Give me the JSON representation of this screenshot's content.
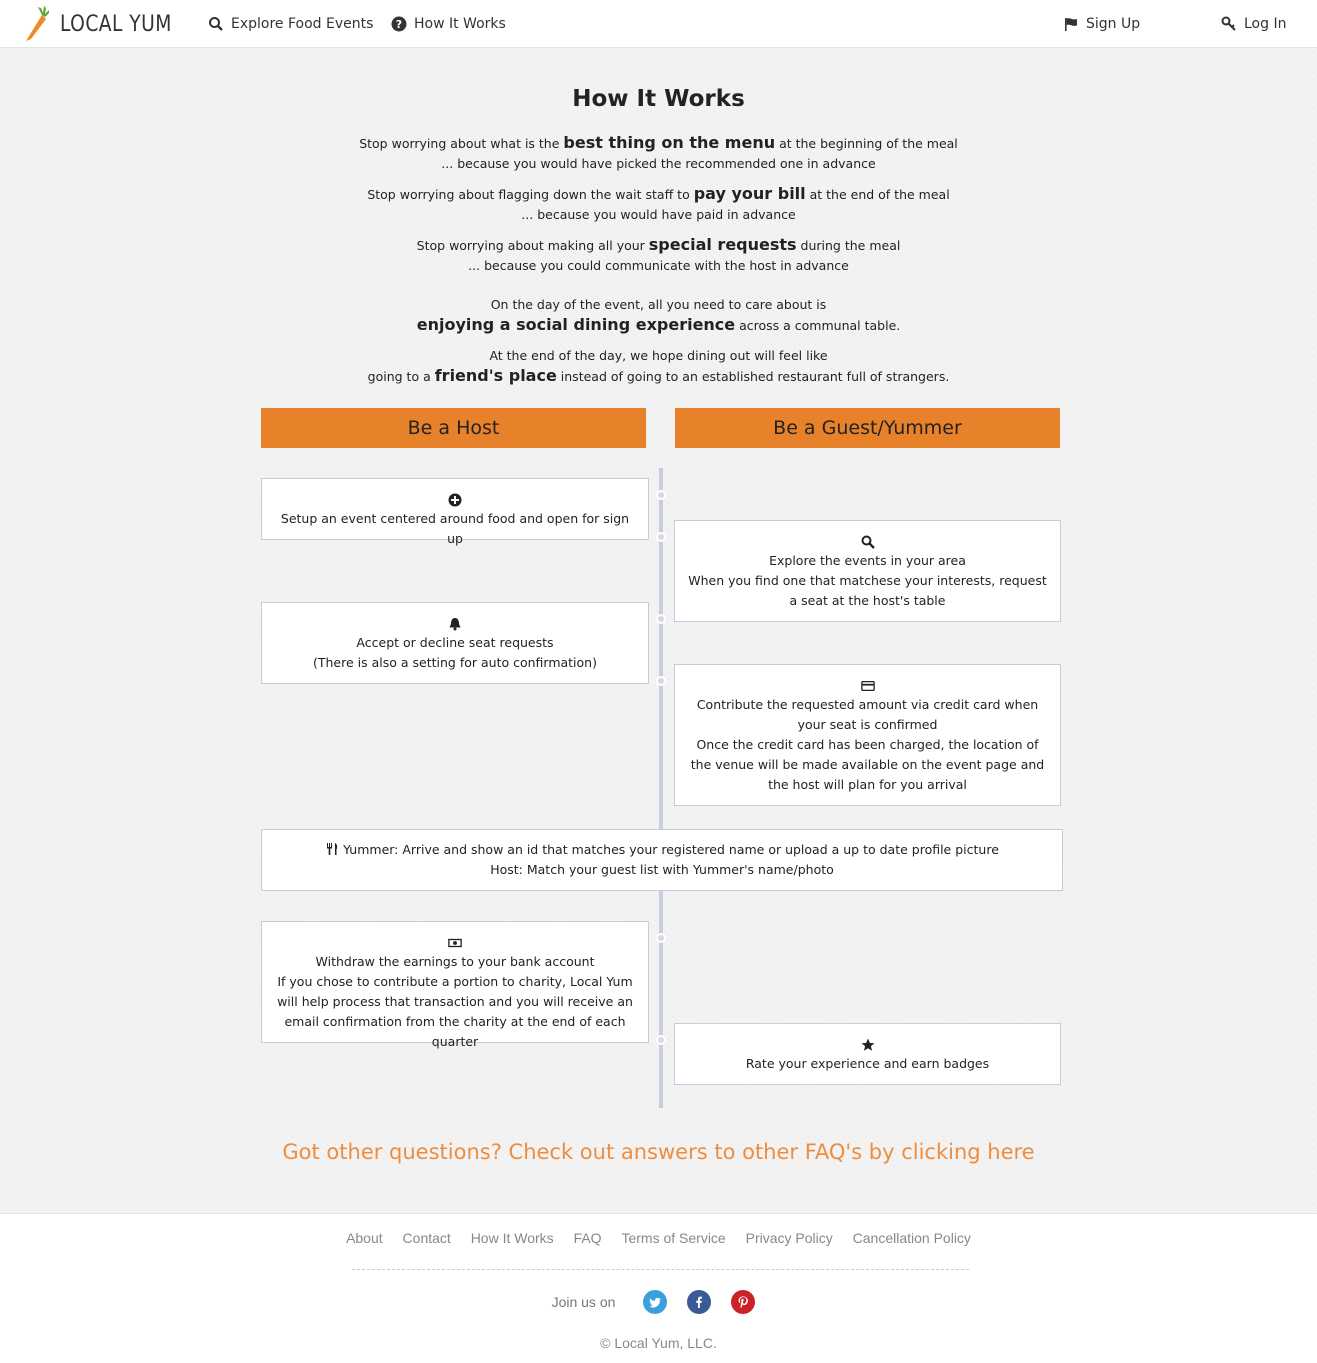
{
  "navbar": {
    "brand": "LOCAL YUM",
    "explore_label": "Explore Food Events",
    "how_label": "How It Works",
    "signup_label": "Sign Up",
    "login_label": "Log In"
  },
  "page": {
    "title": "How It Works",
    "intro": [
      {
        "pre": "Stop worrying about what is the ",
        "bold": "best thing on the menu",
        "post": " at the beginning of the meal",
        "line2": "... because you would have picked the recommended one in advance"
      },
      {
        "pre": "Stop worrying about flagging down the wait staff to ",
        "bold": "pay your bill",
        "post": " at the end of the meal",
        "line2": "... because you would have paid in advance"
      },
      {
        "pre": "Stop worrying about making all your ",
        "bold": "special requests",
        "post": " during the meal",
        "line2": "... because you could communicate with the host in advance"
      }
    ],
    "day": {
      "line1": "On the day of the event, all you need to care about is",
      "bold": "enjoying a social dining experience",
      "post": " across a communal table."
    },
    "end": {
      "line1": "At the end of the day, we hope dining out will feel like",
      "pre": "going to a ",
      "bold": "friend's place",
      "post": " instead of going to an established restaurant full of strangers."
    }
  },
  "columns": {
    "host": "Be a Host",
    "guest": "Be a Guest/Yummer"
  },
  "steps": {
    "setup": {
      "icon": "plus-circle-icon",
      "line1": "Setup an event centered around food and open for sign up"
    },
    "explore": {
      "icon": "search-icon",
      "line1": "Explore the events in your area",
      "line2": "When you find one that matchese your interests, request a seat at the host's table"
    },
    "accept": {
      "icon": "bell-icon",
      "line1": "Accept or decline seat requests",
      "line2": "(There is also a setting for auto confirmation)"
    },
    "contribute": {
      "icon": "credit-card-icon",
      "line1": "Contribute the requested amount via credit card when your seat is confirmed",
      "line2": "Once the credit card has been charged, the location of the venue will be made available on the event page and the host will plan for you arrival"
    },
    "arrive": {
      "icon": "cutlery-icon",
      "line1": "Yummer: Arrive and show an id that matches your registered name or upload a up to date profile picture",
      "line2": "Host: Match your guest list with Yummer's name/photo"
    },
    "withdraw": {
      "icon": "money-icon",
      "line1": "Withdraw the earnings to your bank account",
      "line2": "If you chose to contribute a portion to charity, Local Yum will help process that transaction and you will receive an email confirmation from the charity at the end of each quarter"
    },
    "rate": {
      "icon": "star-icon",
      "line1": "Rate your experience and earn badges"
    }
  },
  "faq_link": "Got other questions? Check out answers to other FAQ's by clicking here",
  "footer": {
    "links": [
      "About",
      "Contact",
      "How It Works",
      "FAQ",
      "Terms of Service",
      "Privacy Policy",
      "Cancellation Policy"
    ],
    "join_label": "Join us on",
    "copyright": "© Local Yum, LLC."
  },
  "colors": {
    "accent": "#e8822a",
    "faq": "#ef8d3f",
    "twitter": "#3aa0db",
    "facebook": "#3a5997",
    "pinterest": "#cc2127"
  }
}
